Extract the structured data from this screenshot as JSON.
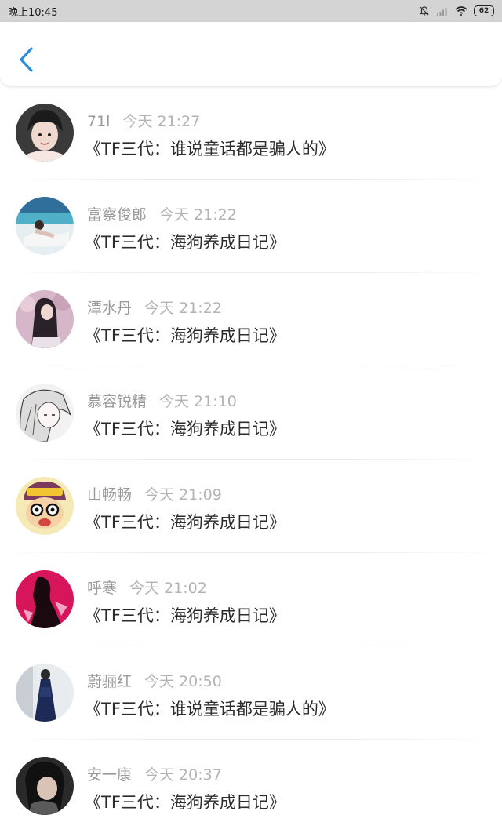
{
  "status_bar": {
    "time": "晚上10:45",
    "battery": "62",
    "icons": [
      "mute-bell-icon",
      "signal-icon",
      "wifi-icon",
      "battery-icon"
    ]
  },
  "header": {
    "back_icon": "chevron-left-icon",
    "accent_color": "#2b8de0"
  },
  "items": [
    {
      "name": "71l",
      "time": "今天 21:27",
      "title": "《TF三代：谁说童话都是骗人的》"
    },
    {
      "name": "富察俊郎",
      "time": "今天 21:22",
      "title": "《TF三代：海狗养成日记》"
    },
    {
      "name": "潭水丹",
      "time": "今天 21:22",
      "title": "《TF三代：海狗养成日记》"
    },
    {
      "name": "慕容锐精",
      "time": "今天 21:10",
      "title": "《TF三代：海狗养成日记》"
    },
    {
      "name": "山畅畅",
      "time": "今天 21:09",
      "title": "《TF三代：海狗养成日记》"
    },
    {
      "name": "呼寒",
      "time": "今天 21:02",
      "title": "《TF三代：海狗养成日记》"
    },
    {
      "name": "蔚骊红",
      "time": "今天 20:50",
      "title": "《TF三代：谁说童话都是骗人的》"
    },
    {
      "name": "安一康",
      "time": "今天 20:37",
      "title": "《TF三代：海狗养成日记》"
    }
  ]
}
